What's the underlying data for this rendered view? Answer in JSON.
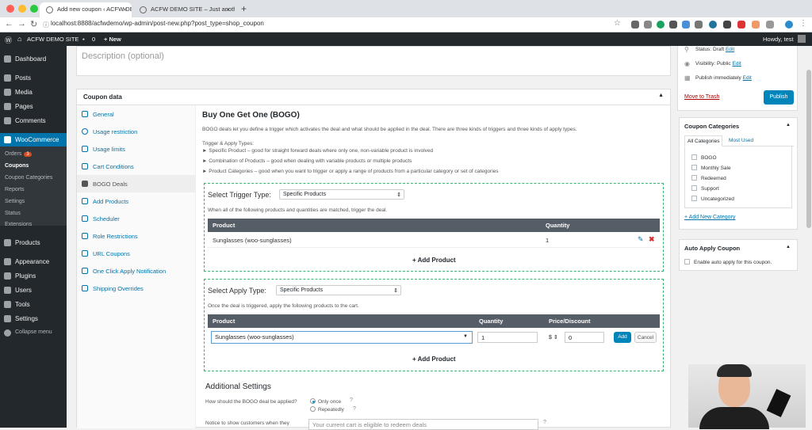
{
  "browser": {
    "tabs": [
      {
        "title": "Add new coupon ‹ ACFW DEM..."
      },
      {
        "title": "ACFW DEMO SITE – Just anoth..."
      }
    ],
    "new_tab": "+",
    "url": "localhost:8888/acfwdemo/wp-admin/post-new.php?post_type=shop_coupon"
  },
  "adminbar": {
    "site": "ACFW DEMO SITE",
    "comments": "0",
    "new": "+ New",
    "greeting": "Howdy, test"
  },
  "sidebar": {
    "items": [
      "Dashboard",
      "Posts",
      "Media",
      "Pages",
      "Comments",
      "WooCommerce",
      "Products",
      "Appearance",
      "Plugins",
      "Users",
      "Tools",
      "Settings",
      "Collapse menu"
    ],
    "woo_sub": [
      "Orders",
      "Coupons",
      "Coupon Categories",
      "Reports",
      "Settings",
      "Status",
      "Extensions"
    ],
    "orders_badge": "3"
  },
  "editor": {
    "description_placeholder": "Description (optional)"
  },
  "coupon_data": {
    "title": "Coupon data",
    "tabs": [
      "General",
      "Usage restriction",
      "Usage limits",
      "Cart Conditions",
      "BOGO Deals",
      "Add Products",
      "Scheduler",
      "Role Restrictions",
      "URL Coupons",
      "One Click Apply Notification",
      "Shipping Overrides"
    ]
  },
  "bogo": {
    "title": "Buy One Get One (BOGO)",
    "intro": "BOGO deals let you define a trigger which activates the deal and what should be applied in the deal. There are three kinds of triggers and three kinds of apply types.",
    "types_heading": "Trigger & Apply Types:",
    "types": [
      "► Specific Product – good for straight forward deals where only one, non-variable product is involved",
      "► Combination of Products – good when dealing with variable products or multiple products",
      "► Product Categories – good when you want to trigger or apply a range of products from a particular category or set of categories"
    ],
    "trigger": {
      "label": "Select Trigger Type:",
      "value": "Specific Products",
      "help": "When all of the following products and quantities are matched, trigger the deal.",
      "col_product": "Product",
      "col_quantity": "Quantity",
      "row_product": "Sunglasses (woo-sunglasses)",
      "row_quantity": "1",
      "add": "+ Add Product"
    },
    "apply": {
      "label": "Select Apply Type:",
      "value": "Specific Products",
      "help": "Once the deal is triggered, apply the following products to the cart.",
      "col_product": "Product",
      "col_quantity": "Quantity",
      "col_price": "Price/Discount",
      "product_value": "Sunglasses (woo-sunglasses)",
      "quantity_value": "1",
      "currency": "$",
      "discount_value": "0",
      "add_btn": "Add",
      "cancel_btn": "Cancel",
      "add": "+ Add Product"
    },
    "additional": {
      "title": "Additional Settings",
      "question": "How should the BOGO deal be applied?",
      "opt1": "Only once",
      "opt2": "Repeatedly",
      "notice_label": "Notice to show customers when they",
      "notice_value": "Your current cart is eligible to redeem deals"
    }
  },
  "publish": {
    "status": "Status: Draft",
    "status_edit": "Edit",
    "visibility": "Visibility: Public",
    "visibility_edit": "Edit",
    "publish_when": "Publish immediately",
    "publish_edit": "Edit",
    "trash": "Move to Trash",
    "button": "Publish"
  },
  "categories": {
    "title": "Coupon Categories",
    "tab_all": "All Categories",
    "tab_most": "Most Used",
    "items": [
      "BOGO",
      "Monthly Sale",
      "Redeemed",
      "Support",
      "Uncategorized"
    ],
    "add": "+ Add New Category"
  },
  "auto_apply": {
    "title": "Auto Apply Coupon",
    "label": "Enable auto apply for this coupon."
  },
  "colors": {
    "accent": "#0073aa",
    "admin_bg": "#23282d",
    "dashed": "#3cb371",
    "delete": "#dc3232"
  }
}
